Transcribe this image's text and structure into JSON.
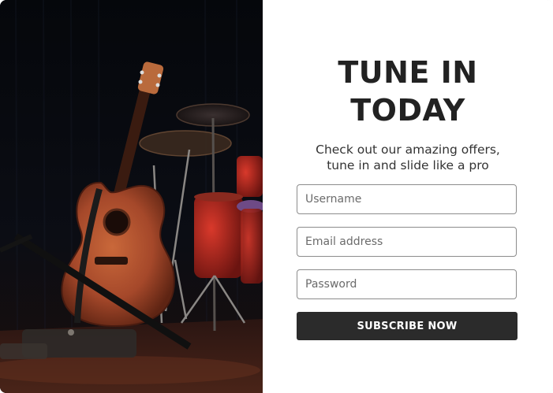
{
  "hero": {
    "image": "acoustic-guitar-on-stage-with-drum-kit-photo"
  },
  "signup": {
    "title_line1": "TUNE IN",
    "title_line2": "TODAY",
    "subtitle_line1": "Check out our amazing offers,",
    "subtitle_line2": "tune in and slide like a pro",
    "username_placeholder": "Username",
    "email_placeholder": "Email address",
    "password_placeholder": "Password",
    "submit_label": "SUBSCRIBE NOW"
  },
  "colors": {
    "button_bg": "#2b2b2b",
    "button_text": "#ffffff",
    "title_text": "#222222",
    "input_border": "#8c8c8c"
  }
}
